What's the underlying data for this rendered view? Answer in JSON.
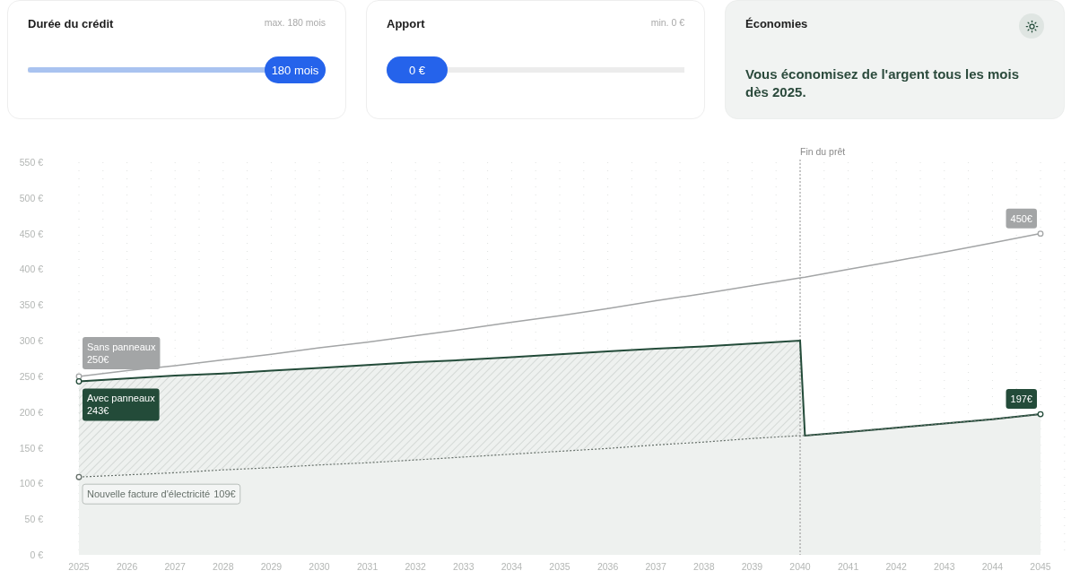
{
  "cards": [
    {
      "kind": "slider",
      "title": "Durée du crédit",
      "hint": "max. 180 mois",
      "value": "180 mois",
      "level": 1
    },
    {
      "kind": "slider",
      "title": "Apport",
      "hint": "min. 0 €",
      "value": "0 €",
      "level": 0
    },
    {
      "kind": "info",
      "title": "Économies",
      "message": "Vous économisez de l'argent tous les mois dès 2025."
    }
  ],
  "chart": {
    "chart_data": {
      "type": "line",
      "x": [
        2025,
        2026,
        2027,
        2028,
        2029,
        2030,
        2031,
        2032,
        2033,
        2034,
        2035,
        2036,
        2037,
        2038,
        2039,
        2040,
        2040.1,
        2041,
        2042,
        2043,
        2044,
        2045
      ],
      "series": [
        {
          "name": "Sans panneaux",
          "color": "#a3a5a6",
          "line_style": "solid",
          "values": [
            250,
            258,
            265,
            273,
            281,
            290,
            298,
            307,
            316,
            326,
            335,
            345,
            356,
            366,
            377,
            388,
            389,
            400,
            412,
            424,
            437,
            450
          ]
        },
        {
          "name": "Avec panneaux",
          "color": "#234b39",
          "line_style": "solid",
          "values": [
            243,
            247,
            251,
            254,
            258,
            262,
            266,
            270,
            273,
            277,
            281,
            285,
            289,
            292,
            296,
            300,
            167,
            172,
            178,
            184,
            190,
            197
          ]
        },
        {
          "name": "Nouvelle facture d'électricité",
          "color": "#66706a",
          "line_style": "dashed",
          "values": [
            109,
            112,
            115,
            119,
            122,
            126,
            129,
            133,
            137,
            141,
            145,
            149,
            154,
            158,
            163,
            167,
            167,
            172,
            178,
            184,
            190,
            197
          ]
        }
      ],
      "xlim": [
        2025,
        2045
      ],
      "ylim": [
        0,
        550
      ],
      "grid": true,
      "yticks": [
        {
          "value": 0,
          "label": "0 €"
        },
        {
          "value": 50,
          "label": "50 €"
        },
        {
          "value": 100,
          "label": "100 €"
        },
        {
          "value": 150,
          "label": "150 €"
        },
        {
          "value": 200,
          "label": "200 €"
        },
        {
          "value": 250,
          "label": "250 €"
        },
        {
          "value": 300,
          "label": "300 €"
        },
        {
          "value": 350,
          "label": "350 €"
        },
        {
          "value": 400,
          "label": "400 €"
        },
        {
          "value": 450,
          "label": "450 €"
        },
        {
          "value": 500,
          "label": "500 €"
        },
        {
          "value": 550,
          "label": "550 €"
        }
      ],
      "xticks": [
        2025,
        2026,
        2027,
        2028,
        2029,
        2030,
        2031,
        2032,
        2033,
        2034,
        2035,
        2036,
        2037,
        2038,
        2039,
        2040,
        2041,
        2042,
        2043,
        2044,
        2045
      ],
      "ref_lines": [
        {
          "axis": "x",
          "value": 2040,
          "label": "Fin du prêt"
        }
      ],
      "annotations": [
        "250€",
        "243€",
        "109€",
        "450€",
        "197€"
      ]
    }
  }
}
